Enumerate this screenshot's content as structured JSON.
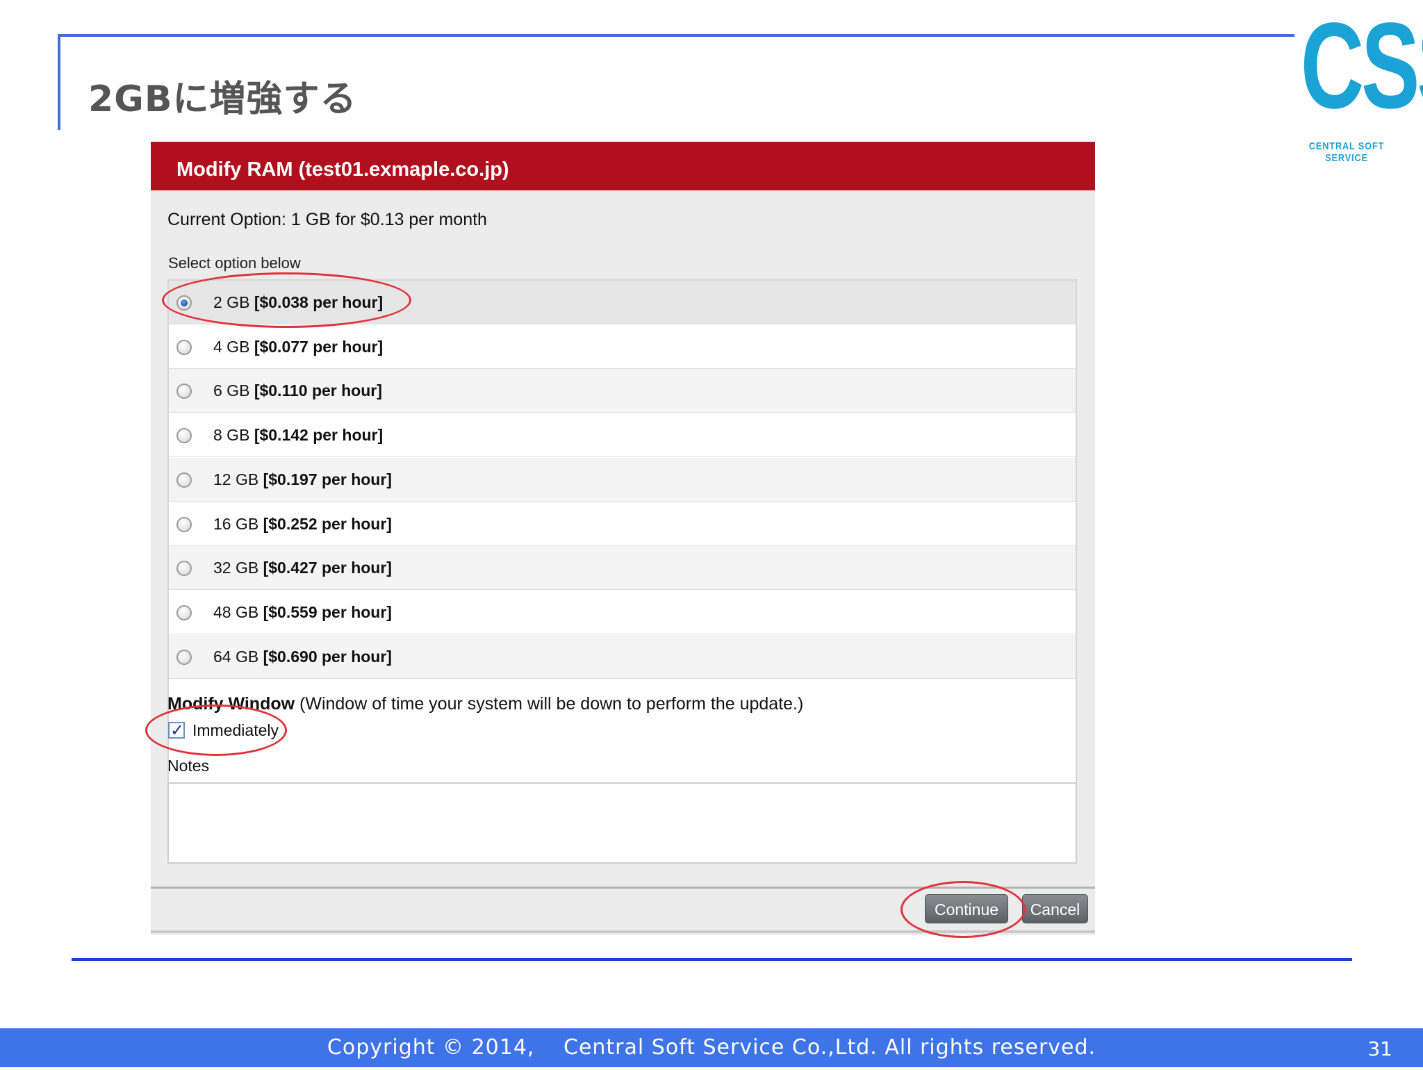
{
  "slide": {
    "title": "2GBに増強する",
    "logo_text": "CSS",
    "logo_subtext": "CENTRAL SOFT SERVICE",
    "footer_copyright": "Copyright © 2014,　 Central Soft Service Co.,Ltd. All rights reserved.",
    "page_number": "31"
  },
  "dialog": {
    "title": "Modify RAM (test01.exmaple.co.jp)",
    "current_option": "Current Option: 1 GB for $0.13 per month",
    "select_label": "Select option below",
    "options": [
      {
        "size": "2 GB",
        "price": "[$0.038 per hour]",
        "selected": true
      },
      {
        "size": "4 GB",
        "price": "[$0.077 per hour]",
        "selected": false
      },
      {
        "size": "6 GB",
        "price": "[$0.110 per hour]",
        "selected": false
      },
      {
        "size": "8 GB",
        "price": "[$0.142 per hour]",
        "selected": false
      },
      {
        "size": "12 GB",
        "price": "[$0.197 per hour]",
        "selected": false
      },
      {
        "size": "16 GB",
        "price": "[$0.252 per hour]",
        "selected": false
      },
      {
        "size": "32 GB",
        "price": "[$0.427 per hour]",
        "selected": false
      },
      {
        "size": "48 GB",
        "price": "[$0.559 per hour]",
        "selected": false
      },
      {
        "size": "64 GB",
        "price": "[$0.690 per hour]",
        "selected": false
      }
    ],
    "modify_window_heading": "Modify Window",
    "modify_window_note": " (Window of time your system will be down to perform the update.)",
    "immediately_label": "Immediately",
    "immediately_checked": true,
    "notes_label": "Notes",
    "notes_value": "",
    "continue_label": "Continue",
    "cancel_label": "Cancel"
  },
  "colors": {
    "header_red": "#b0101e",
    "slide_blue": "#3f6fd6",
    "footer_blue": "#3f73e8",
    "logo_cyan": "#1ba3d6",
    "annotation_red": "#e2323a"
  }
}
